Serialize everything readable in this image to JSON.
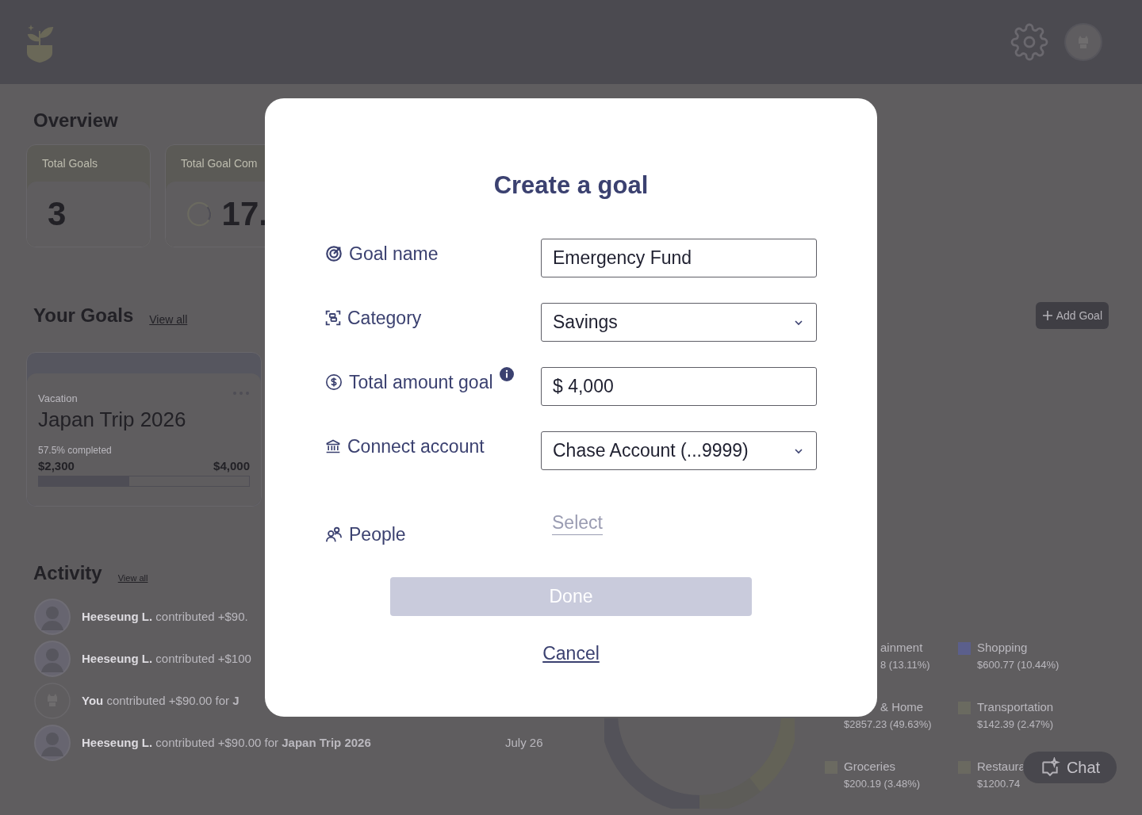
{
  "overview": {
    "title": "Overview",
    "stats": [
      {
        "kind": "number",
        "label": "Total Goals",
        "value": "3"
      },
      {
        "kind": "ring",
        "label": "Total Goal Com",
        "value": "17."
      }
    ]
  },
  "goals": {
    "title": "Your Goals",
    "view_all": "View all",
    "add_button": "Add Goal",
    "cards": [
      {
        "category": "Vacation",
        "name": "Japan Trip 2026",
        "progress_text": "57.5% completed",
        "saved": "$2,300",
        "target": "$4,000",
        "level": 0.43
      }
    ]
  },
  "activity": {
    "title": "Activity",
    "view_all": "View all",
    "rows": [
      {
        "kind": "photo",
        "name": "Heeseung L.",
        "text": "contributed +$90."
      },
      {
        "kind": "photo",
        "name": "Heeseung L.",
        "text": "contributed +$100"
      },
      {
        "kind": "icon",
        "name": "You",
        "text": "contributed +$90.00 for **J**"
      },
      {
        "kind": "photo",
        "name": "Heeseung L.",
        "text": "contributed +$90.00 for **Japan Trip 2026**",
        "date": "July 26"
      }
    ]
  },
  "spending": {
    "legend": [
      {
        "label": "ainment",
        "value": "8 (13.11%)"
      },
      {
        "label": "Shopping",
        "value": "$600.77 (10.44%)",
        "color": "#5b5f8c"
      },
      {
        "label": "& Home",
        "value": "$2857.23 (49.63%)"
      },
      {
        "label": "Transportation",
        "value": "$142.39 (2.47%)",
        "color": "#6a6a60"
      },
      {
        "label": "Groceries",
        "value": "$200.19 (3.48%)",
        "color": "#6b6a61"
      },
      {
        "label": "Restaura",
        "value": "$1200.74",
        "color": "#6a6960"
      }
    ]
  },
  "chat_button": "Chat",
  "modal": {
    "title": "Create a goal",
    "fields": [
      {
        "kind": "text",
        "label": "Goal name",
        "value": "Emergency Fund"
      },
      {
        "kind": "select",
        "label": "Category",
        "value": "Savings"
      },
      {
        "kind": "text",
        "label": "Total amount goal",
        "value": "$ 4,000",
        "info": true
      },
      {
        "kind": "select",
        "label": "Connect account",
        "value": "Chase Account (...9999)"
      },
      {
        "kind": "people",
        "label": "People",
        "placeholder": "Select"
      }
    ],
    "done": {
      "label": "Done",
      "disabled": true
    },
    "cancel": "Cancel"
  }
}
